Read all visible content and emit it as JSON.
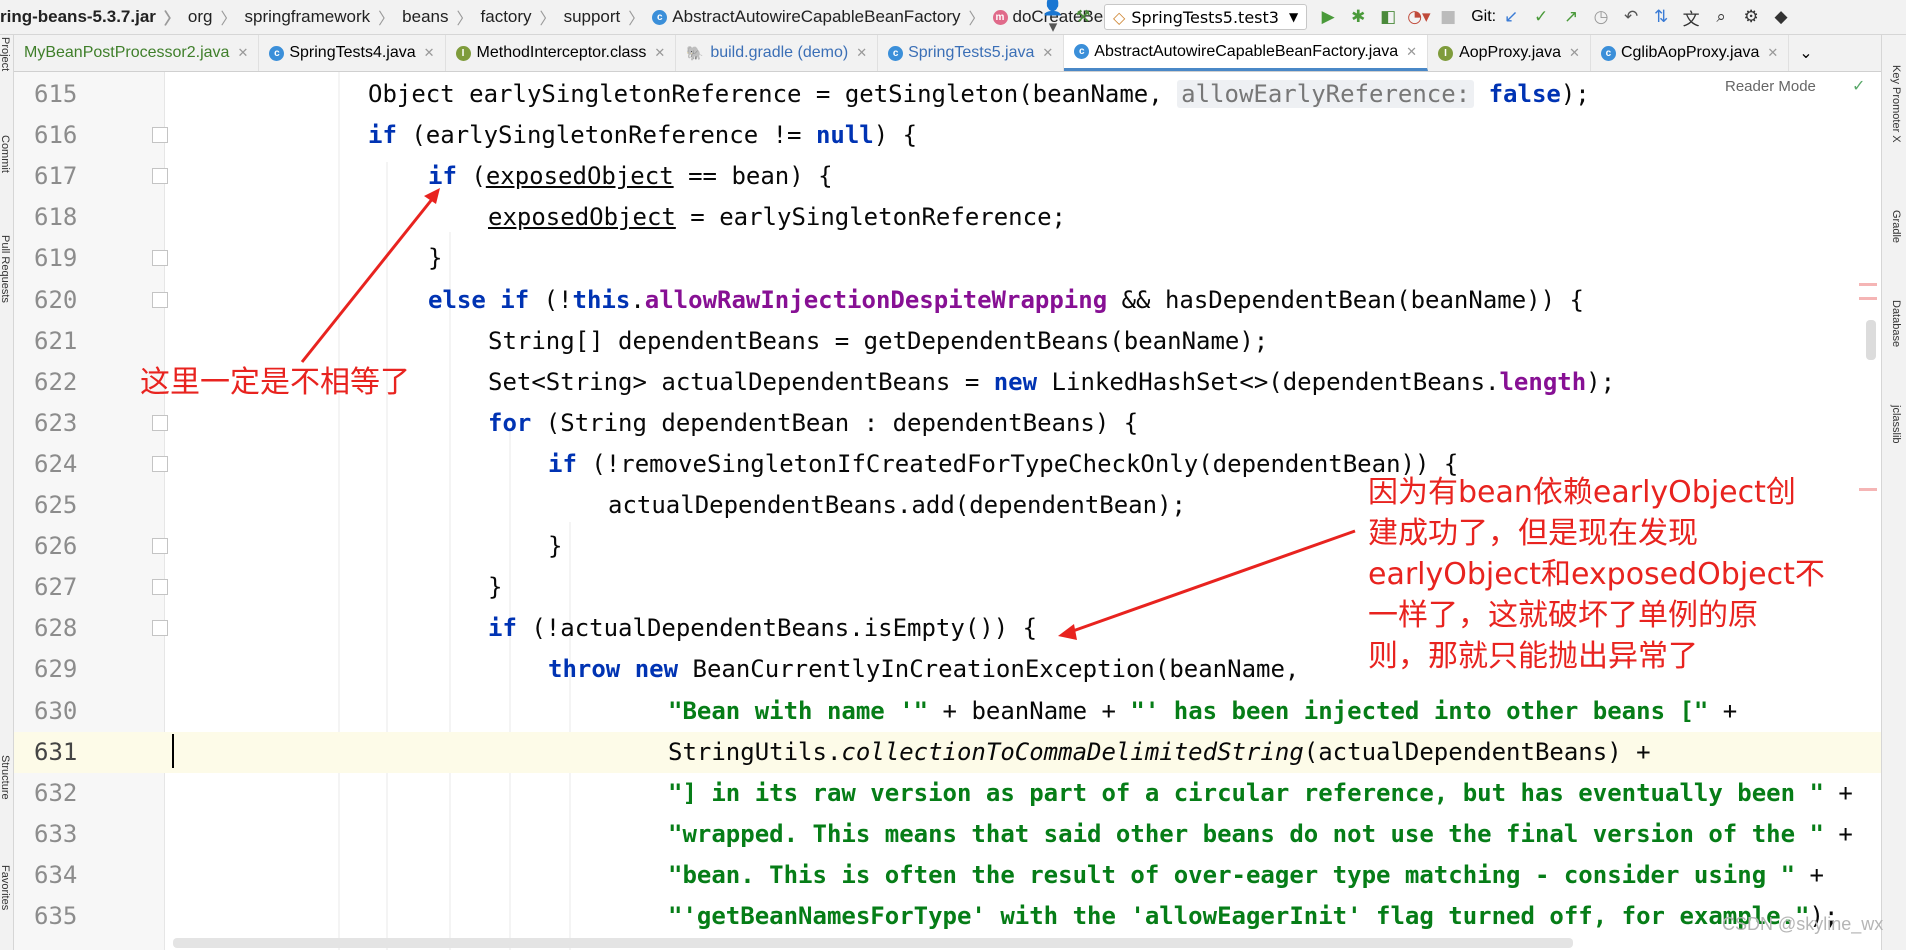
{
  "breadcrumb": {
    "items": [
      "ring-beans-5.3.7.jar",
      "org",
      "springframework",
      "beans",
      "factory",
      "support",
      "AbstractAutowireCapableBeanFactory",
      "doCreateBean"
    ]
  },
  "toolbar": {
    "run_config": "SpringTests5.test3",
    "git_label": "Git:"
  },
  "tabs": [
    {
      "label": "MyBeanPostProcessor2.java",
      "icon": "class-icon",
      "active": false
    },
    {
      "label": "SpringTests4.java",
      "icon": "class-icon",
      "active": false
    },
    {
      "label": "MethodInterceptor.class",
      "icon": "interface-icon",
      "active": false
    },
    {
      "label": "build.gradle (demo)",
      "icon": "gradle-icon",
      "active": false
    },
    {
      "label": "SpringTests5.java",
      "icon": "class-icon",
      "active": false
    },
    {
      "label": "AbstractAutowireCapableBeanFactory.java",
      "icon": "class-icon",
      "active": true
    },
    {
      "label": "AopProxy.java",
      "icon": "interface-icon",
      "active": false
    },
    {
      "label": "CglibAopProxy.java",
      "icon": "class-icon",
      "active": false
    }
  ],
  "left_tools": [
    "Project",
    "Commit",
    "Pull Requests",
    "Structure",
    "Favorites"
  ],
  "right_tools": [
    "Key Promoter X",
    "Gradle",
    "Database",
    "jclasslib"
  ],
  "editor": {
    "reader_mode": "Reader Mode",
    "lines": [
      {
        "num": "615",
        "text": "Object earlySingletonReference = getSingleton(beanName, allowEarlyReference: false);"
      },
      {
        "num": "616",
        "text": "if (earlySingletonReference != null) {"
      },
      {
        "num": "617",
        "text": "if (exposedObject == bean) {"
      },
      {
        "num": "618",
        "text": "exposedObject = earlySingletonReference;"
      },
      {
        "num": "619",
        "text": "}"
      },
      {
        "num": "620",
        "text": "else if (!this.allowRawInjectionDespiteWrapping && hasDependentBean(beanName)) {"
      },
      {
        "num": "621",
        "text": "String[] dependentBeans = getDependentBeans(beanName);"
      },
      {
        "num": "622",
        "text": "Set<String> actualDependentBeans = new LinkedHashSet<>(dependentBeans.length);"
      },
      {
        "num": "623",
        "text": "for (String dependentBean : dependentBeans) {"
      },
      {
        "num": "624",
        "text": "if (!removeSingletonIfCreatedForTypeCheckOnly(dependentBean)) {"
      },
      {
        "num": "625",
        "text": "actualDependentBeans.add(dependentBean);"
      },
      {
        "num": "626",
        "text": "}"
      },
      {
        "num": "627",
        "text": "}"
      },
      {
        "num": "628",
        "text": "if (!actualDependentBeans.isEmpty()) {"
      },
      {
        "num": "629",
        "text": "throw new BeanCurrentlyInCreationException(beanName,"
      },
      {
        "num": "630",
        "text": "\"Bean with name '\" + beanName + \"' has been injected into other beans [\" +"
      },
      {
        "num": "631",
        "text": "StringUtils.collectionToCommaDelimitedString(actualDependentBeans) +"
      },
      {
        "num": "632",
        "text": "\"] in its raw version as part of a circular reference, but has eventually been \" +"
      },
      {
        "num": "633",
        "text": "\"wrapped. This means that said other beans do not use the final version of the \" +"
      },
      {
        "num": "634",
        "text": "\"bean. This is often the result of over-eager type matching - consider using \" +"
      },
      {
        "num": "635",
        "text": "\"'getBeanNamesForType' with the 'allowEagerInit' flag turned off, for example.\");"
      }
    ]
  },
  "annotations": {
    "left_note": "这里一定是不相等了",
    "right_note": [
      "因为有bean依赖earlyObject创",
      "建成功了，但是现在发现",
      "earlyObject和exposedObject不",
      "一样了，这就破坏了单例的原",
      "则，那就只能抛出异常了"
    ]
  },
  "watermark": "CSDN @skyline_wx",
  "colors": {
    "annotation": "#e8231f",
    "keyword": "#0033b3",
    "string": "#067d17",
    "field": "#871094"
  }
}
